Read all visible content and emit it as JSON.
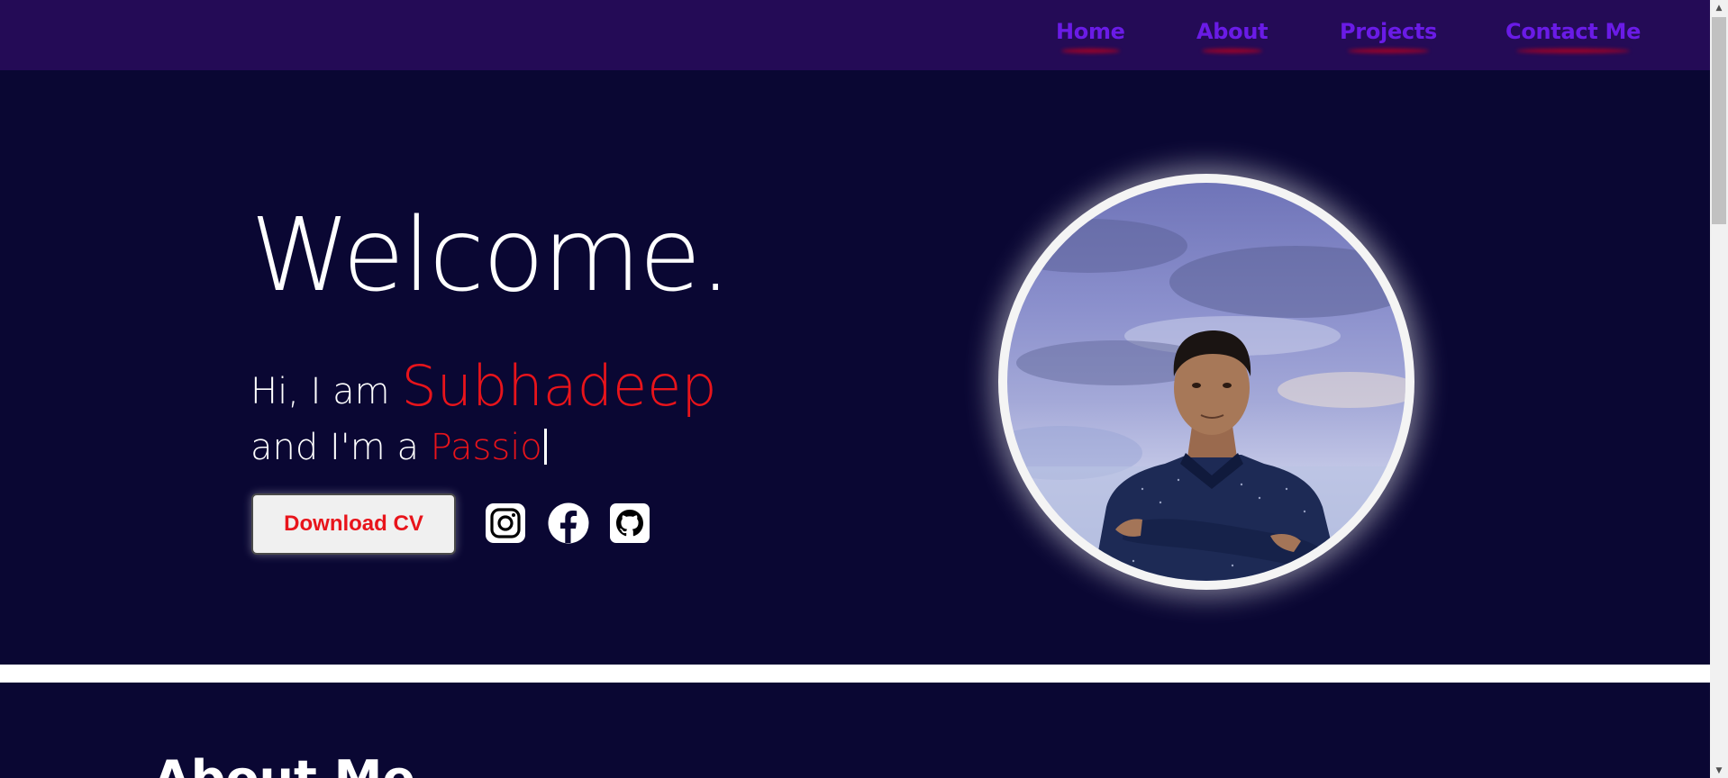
{
  "nav": {
    "items": [
      {
        "label": "Home"
      },
      {
        "label": "About"
      },
      {
        "label": "Projects"
      },
      {
        "label": "Contact Me"
      }
    ]
  },
  "hero": {
    "welcome": "Welcome.",
    "greeting": "Hi, I am ",
    "name": "Subhadeep",
    "role_prefix": "and I'm a ",
    "role_typed": "Passio",
    "download_button": "Download CV",
    "socials": [
      "instagram-icon",
      "facebook-icon",
      "github-icon"
    ],
    "avatar": "profile-photo"
  },
  "about": {
    "title": "About Me"
  },
  "colors": {
    "nav_bg": "#240b56",
    "nav_link": "#6a1be6",
    "page_bg": "#0a0733",
    "accent": "#e8141b",
    "text": "#ffffff"
  }
}
